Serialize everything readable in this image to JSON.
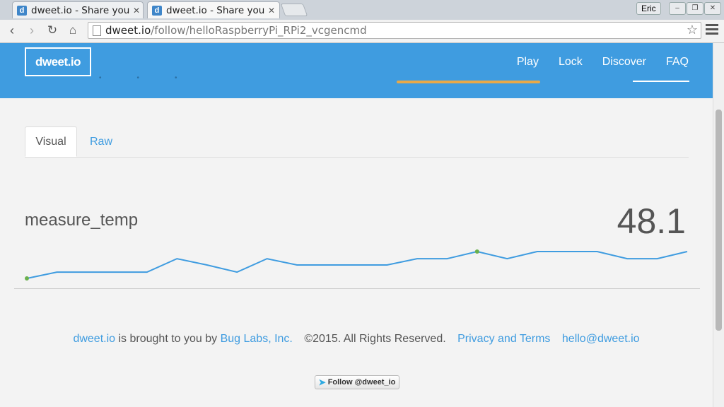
{
  "browser": {
    "tabs": [
      {
        "title": "dweet.io - Share you",
        "favicon": "d"
      },
      {
        "title": "dweet.io - Share you",
        "favicon": "d"
      }
    ],
    "user": "Eric",
    "url_host": "dweet.io",
    "url_path": "/follow/helloRaspberryPi_RPi2_vcgencmd"
  },
  "header": {
    "logo": "dweet.io",
    "nav": [
      "Play",
      "Lock",
      "Discover",
      "FAQ"
    ],
    "accent_color": "#3f9ce0"
  },
  "tabs": {
    "visual": "Visual",
    "raw": "Raw"
  },
  "metric": {
    "name": "measure_temp",
    "value": "48.1",
    "series": [
      44.8,
      45.5,
      45.5,
      45.5,
      45.5,
      47.0,
      46.3,
      45.5,
      47.0,
      46.3,
      46.3,
      46.3,
      46.3,
      47.0,
      47.0,
      47.8,
      47.0,
      47.8,
      47.8,
      47.8,
      47.0,
      47.0,
      47.8
    ],
    "line_color": "#3f9ce0",
    "marker_color": "#6ab04c"
  },
  "footer": {
    "site": "dweet.io",
    "brought": " is brought to you by ",
    "company": "Bug Labs, Inc.",
    "copyright": "©2015. All Rights Reserved.",
    "privacy": "Privacy and Terms",
    "email": "hello@dweet.io",
    "twitter": "Follow @dweet_io"
  }
}
